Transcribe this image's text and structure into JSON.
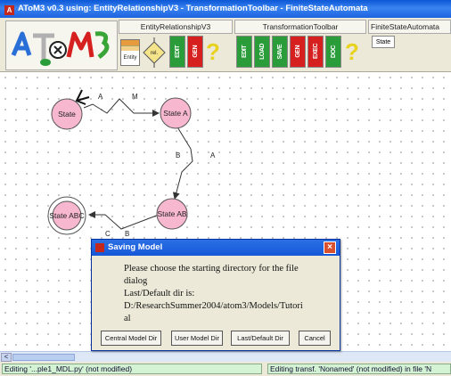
{
  "window": {
    "title": "AToM3 v0.3 using: EntityRelationshipV3 - TransformationToolbar - FiniteStateAutomata",
    "icon": "atom3-app-icon"
  },
  "toolbars": [
    {
      "title": "EntityRelationshipV3",
      "items": [
        {
          "kind": "entity",
          "label": "Entity"
        },
        {
          "kind": "relationship",
          "label": "rel."
        },
        {
          "kind": "button",
          "label": "EDIT",
          "color": "#2a9d3a"
        },
        {
          "kind": "button",
          "label": "GEN",
          "color": "#d62020"
        },
        {
          "kind": "help",
          "label": "?"
        }
      ]
    },
    {
      "title": "TransformationToolbar",
      "items": [
        {
          "kind": "button",
          "label": "EDIT",
          "color": "#2a9d3a"
        },
        {
          "kind": "button",
          "label": "LOAD",
          "color": "#2a9d3a"
        },
        {
          "kind": "button",
          "label": "SAVE",
          "color": "#2a9d3a"
        },
        {
          "kind": "button",
          "label": "GEN",
          "color": "#d62020"
        },
        {
          "kind": "button",
          "label": "EXEC",
          "color": "#d62020"
        },
        {
          "kind": "button",
          "label": "DOC",
          "color": "#2a9d3a"
        },
        {
          "kind": "help",
          "label": "?"
        }
      ]
    },
    {
      "title": "FiniteStateAutomata",
      "items": [
        {
          "kind": "state",
          "label": "State"
        }
      ]
    }
  ],
  "diagram": {
    "states": [
      {
        "label": "State"
      },
      {
        "label": "State A"
      },
      {
        "label": "State AB"
      },
      {
        "label": "State ABC"
      }
    ],
    "transition_labels": [
      "A",
      "M",
      "B",
      "A",
      "B",
      "C"
    ]
  },
  "dialog": {
    "title": "Saving Model",
    "message": [
      "Please choose the starting directory for the file",
      "dialog",
      "Last/Default dir is:",
      "D:/ResearchSummer2004/atom3/Models/Tutori",
      "al"
    ],
    "buttons": [
      "Central Model Dir",
      "User Model Dir",
      "Last/Default Dir",
      "Cancel"
    ],
    "close": "×"
  },
  "scrollbar": {
    "left_arrow": "<"
  },
  "status": {
    "left": "Editing '...ple1_MDL.py' (not modified)",
    "right": "Editing transf. 'Nonamed' (not modified) in file 'N"
  },
  "colors": {
    "state_fill": "#f7b8cf",
    "edit_button": "#2a9d3a",
    "gen_button": "#d62020",
    "status_bg": "#d4f2d4"
  }
}
